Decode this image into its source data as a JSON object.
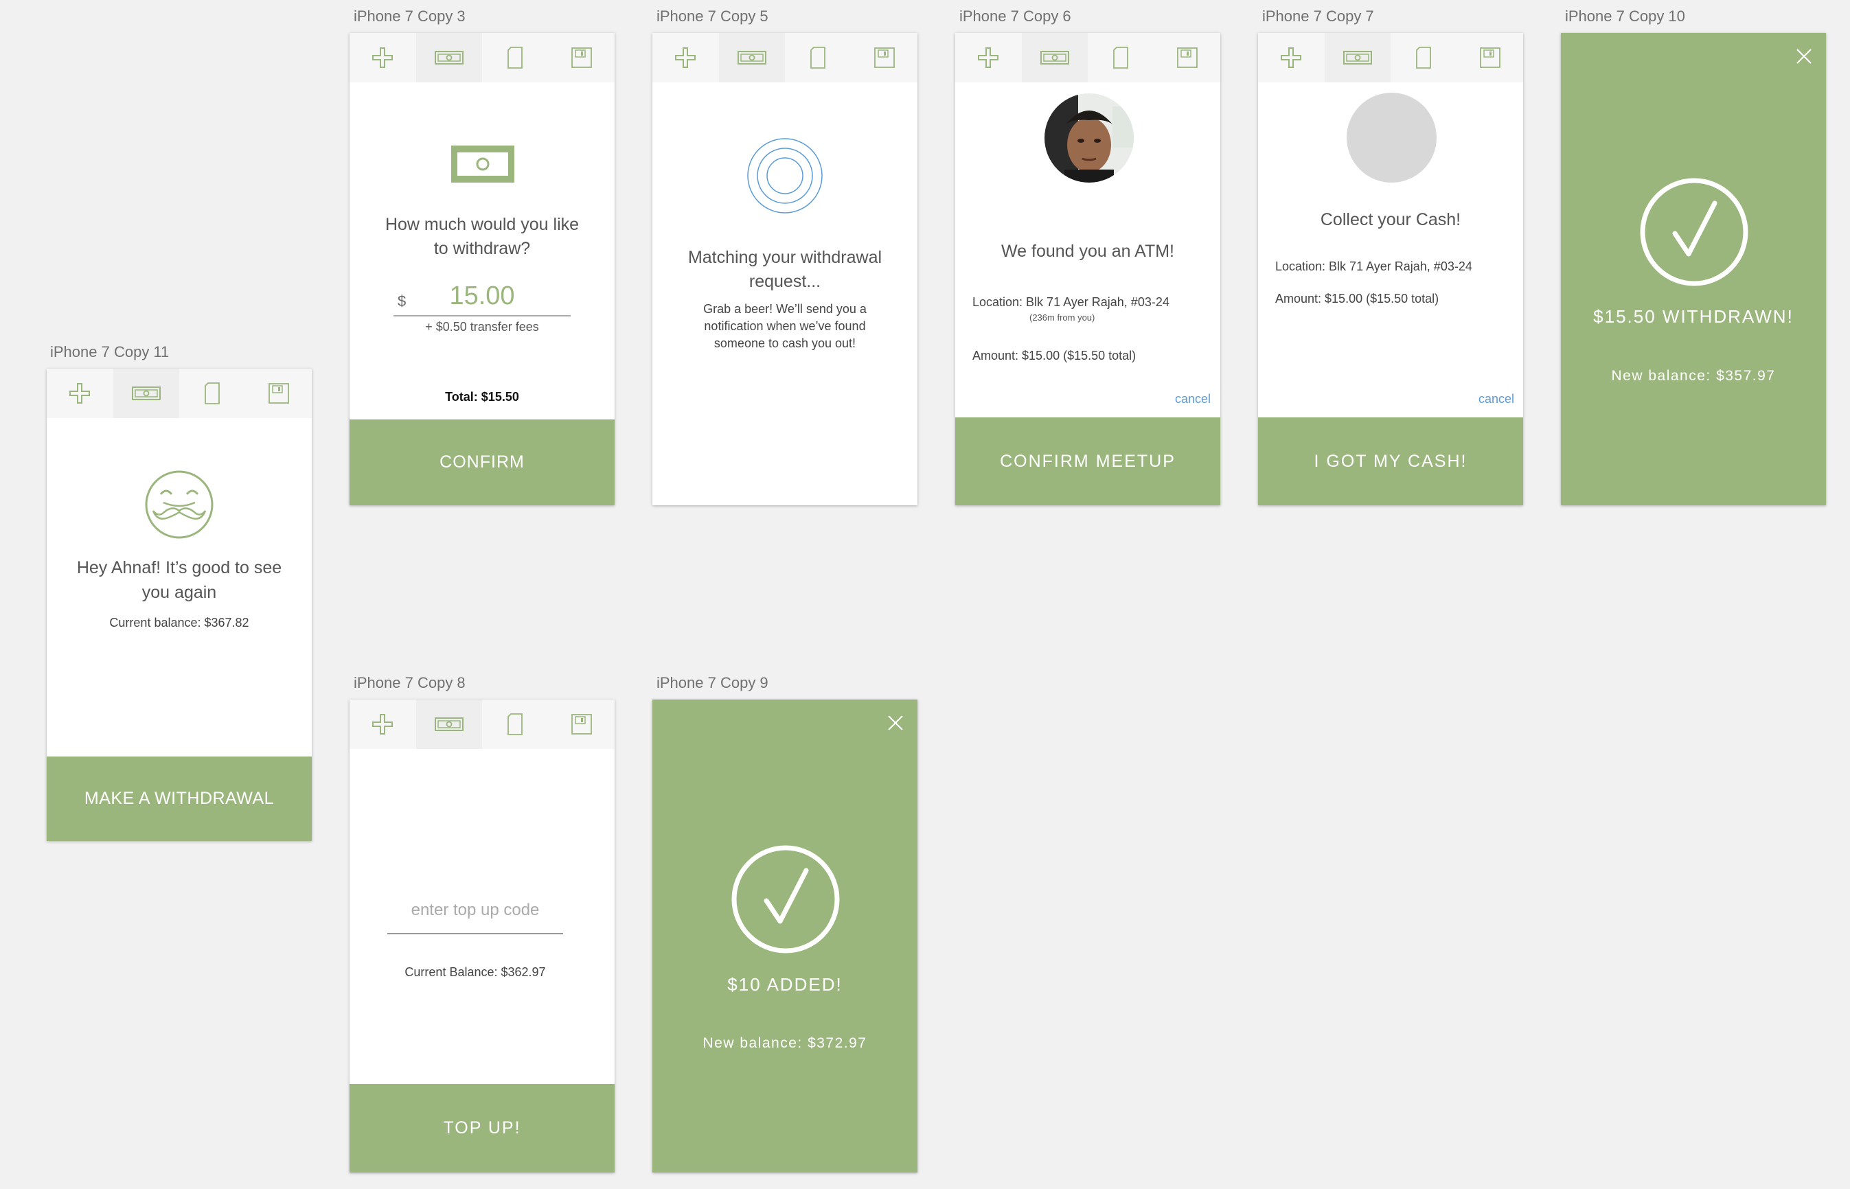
{
  "frames": {
    "copy11": {
      "label": "iPhone 7 Copy 11",
      "greeting": "Hey Ahnaf! It’s good to see you again",
      "balance": "Current balance: $367.82",
      "button": "MAKE A WITHDRAWAL"
    },
    "copy3": {
      "label": "iPhone 7 Copy 3",
      "question": "How much would you like to withdraw?",
      "currency": "$",
      "amount": "15.00",
      "fees": "+ $0.50 transfer fees",
      "total": "Total: $15.50",
      "button": "CONFIRM"
    },
    "copy5": {
      "label": "iPhone 7 Copy 5",
      "title": "Matching your withdrawal request...",
      "message": "Grab a beer! We’ll send you a notification when we’ve found someone to cash you out!"
    },
    "copy6": {
      "label": "iPhone 7 Copy 6",
      "title": "We found you an ATM!",
      "location": "Location: Blk 71 Ayer Rajah, #03-24",
      "distance": "(236m from you)",
      "amount": "Amount: $15.00 ($15.50 total)",
      "cancel": "cancel",
      "button": "CONFIRM MEETUP"
    },
    "copy7": {
      "label": "iPhone 7 Copy 7",
      "title": "Collect your Cash!",
      "location": "Location: Blk 71 Ayer Rajah, #03-24",
      "amount": "Amount: $15.00 ($15.50 total)",
      "cancel": "cancel",
      "button": "I GOT MY CASH!"
    },
    "copy10": {
      "label": "iPhone 7 Copy 10",
      "headline": "$15.50 WITHDRAWN!",
      "balance": "New balance: $357.97"
    },
    "copy8": {
      "label": "iPhone 7 Copy 8",
      "placeholder": "enter top up code",
      "balance": "Current Balance: $362.97",
      "button": "TOP UP!"
    },
    "copy9": {
      "label": "iPhone 7 Copy 9",
      "headline": "$10 ADDED!",
      "balance": "New balance: $372.97"
    }
  },
  "nav_icons": [
    "plus-icon",
    "cash-icon",
    "document-icon",
    "save-icon"
  ],
  "colors": {
    "accent": "#9bb67d",
    "link": "#5a9bd8",
    "background": "#f1f1f1"
  }
}
